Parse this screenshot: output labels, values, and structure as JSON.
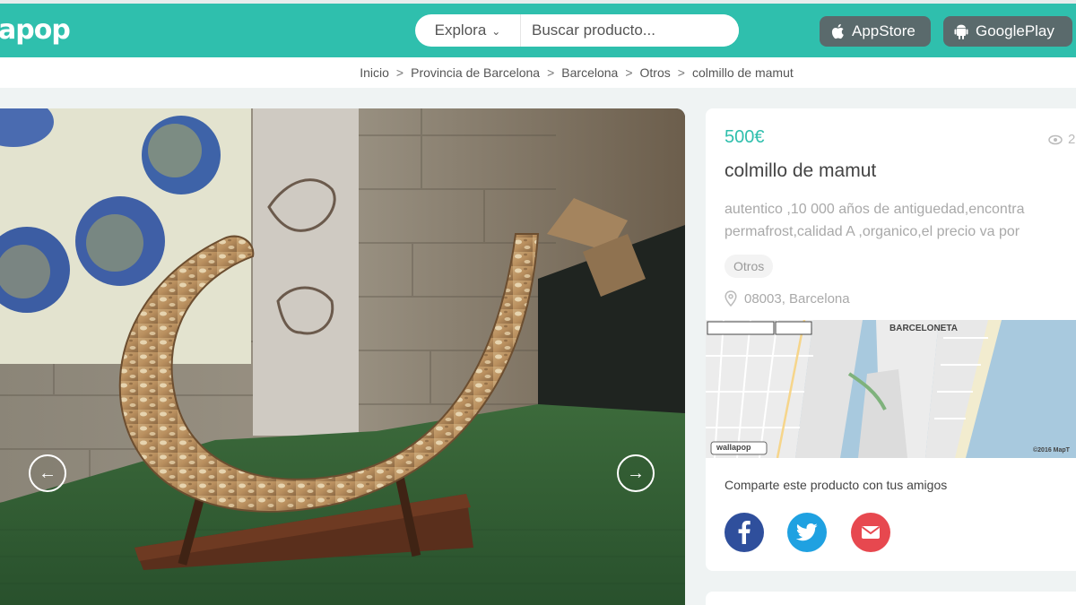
{
  "header": {
    "logo_text": "apop",
    "explore_label": "Explora",
    "search_placeholder": "Buscar producto...",
    "appstore_label": "AppStore",
    "googleplay_label": "GooglePlay",
    "brand_color": "#2fbfad"
  },
  "breadcrumb": {
    "items": [
      "Inicio",
      "Provincia de Barcelona",
      "Barcelona",
      "Otros",
      "colmillo de mamut"
    ],
    "separator": ">"
  },
  "gallery": {
    "prev_icon": "arrow-left-icon",
    "next_icon": "arrow-right-icon"
  },
  "product": {
    "price": "500€",
    "views": "2",
    "title": "colmillo de mamut",
    "description_line1": "autentico ,10 000 años de antiguedad,encontra",
    "description_line2": "permafrost,calidad A ,organico,el precio va por",
    "category_tag": "Otros",
    "location": "08003, Barcelona"
  },
  "map": {
    "label_barceloneta": "BARCELONETA",
    "label_logo": "wallapop",
    "label_copyright": "©2016 MapT"
  },
  "share": {
    "title": "Comparte este producto con tus amigos",
    "facebook_icon": "facebook-icon",
    "twitter_icon": "twitter-icon",
    "mail_icon": "mail-icon"
  }
}
